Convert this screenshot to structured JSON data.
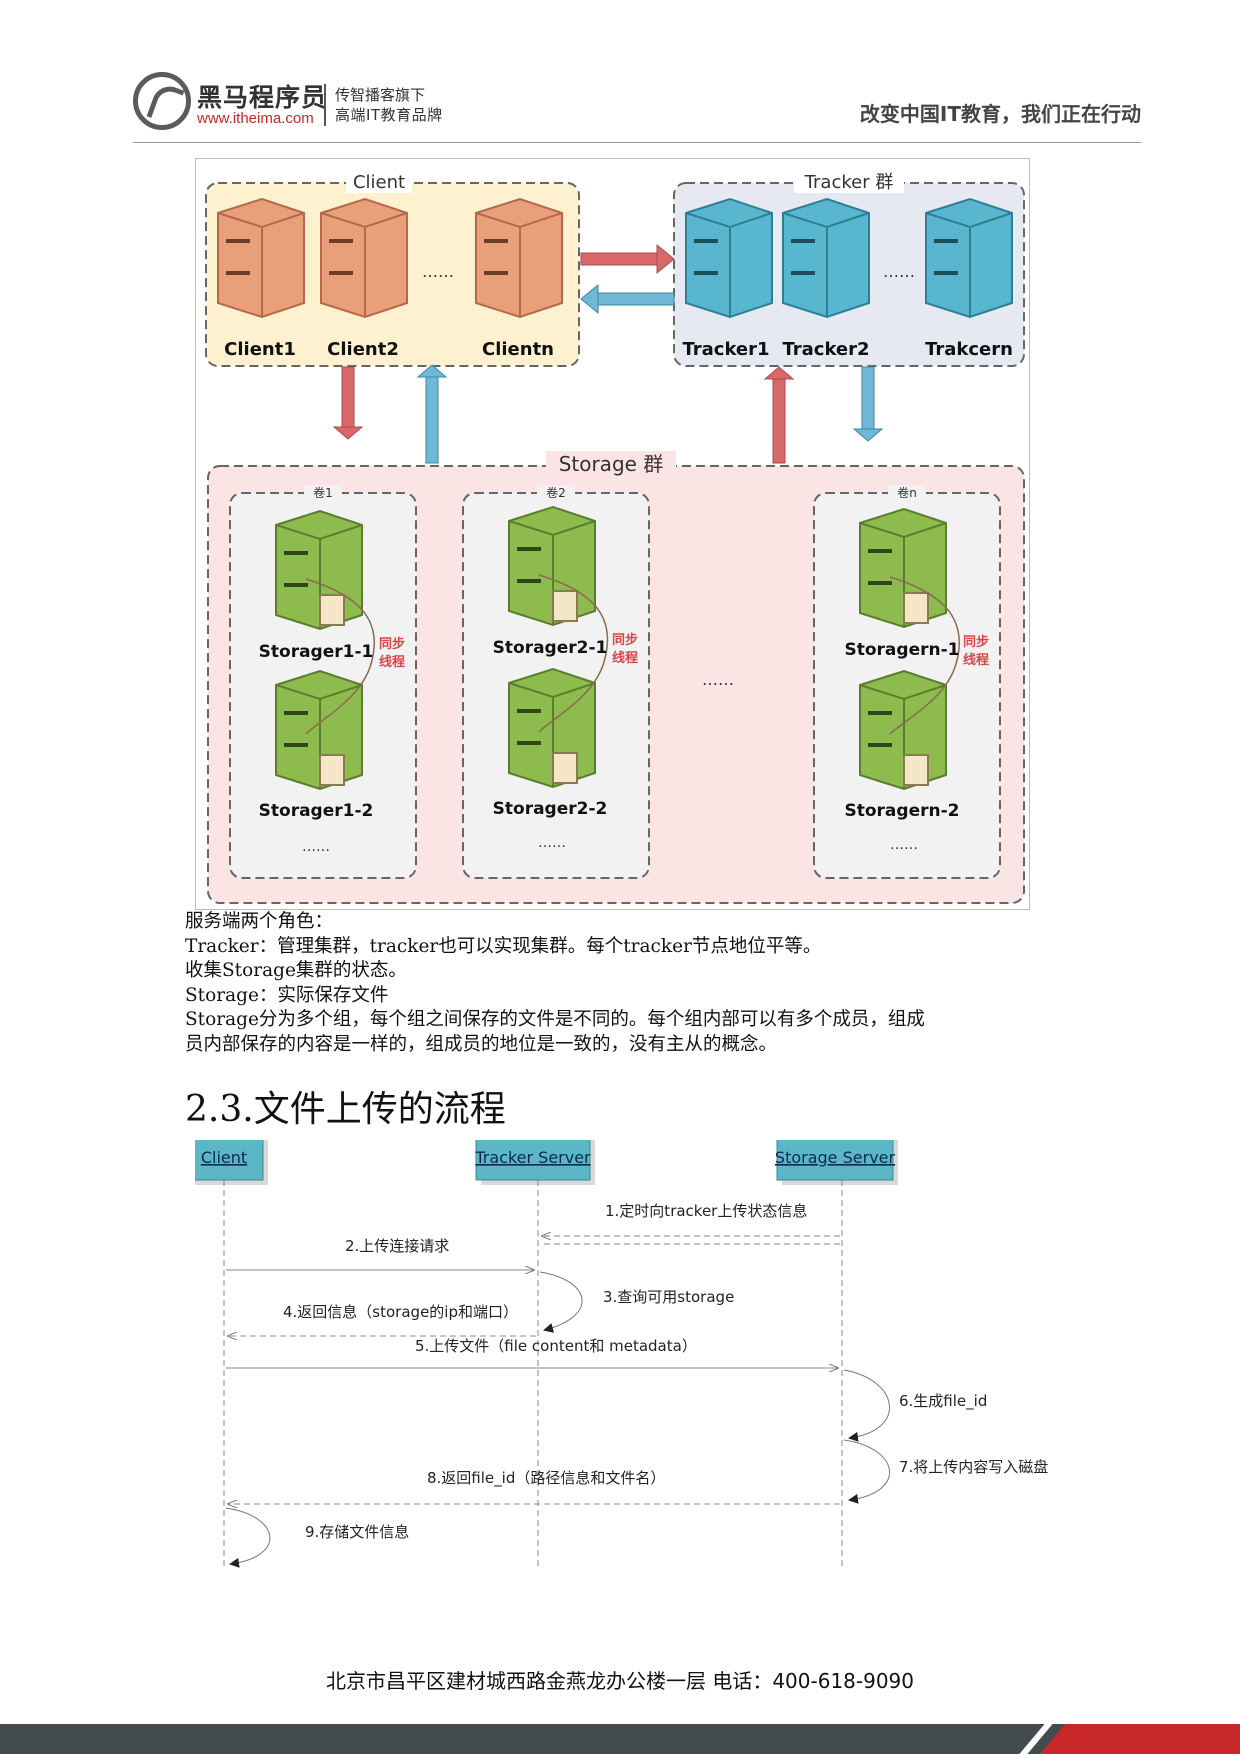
{
  "header": {
    "brand_name": "黑马程序员",
    "brand_url": "www.itheima.com",
    "tagline_1": "传智播客旗下",
    "tagline_2": "高端IT教育品牌",
    "slogan": "改变中国IT教育，我们正在行动"
  },
  "architecture": {
    "client_group": {
      "title": "Client",
      "nodes": [
        "Client1",
        "Client2",
        "Clientn"
      ],
      "ellipsis": "……"
    },
    "tracker_group": {
      "title": "Tracker 群",
      "nodes": [
        "Tracker1",
        "Tracker2",
        "Trakcern"
      ],
      "ellipsis": "……"
    },
    "storage_group": {
      "title": "Storage 群",
      "middle_ellipsis": "……",
      "sync_label_1": "同步",
      "sync_label_2": "线程",
      "volumes": [
        {
          "title": "卷1",
          "nodes": [
            "Storager1-1",
            "Storager1-2"
          ],
          "ellipsis": "……"
        },
        {
          "title": "卷2",
          "nodes": [
            "Storager2-1",
            "Storager2-2"
          ],
          "ellipsis": "……"
        },
        {
          "title": "卷n",
          "nodes": [
            "Storagern-1",
            "Storagern-2"
          ],
          "ellipsis": "……"
        }
      ]
    },
    "colors": {
      "client_fill": "#fdf1cf",
      "tracker_fill": "#e6e9f2",
      "storage_fill": "#fbe4e4",
      "client_server": "#e9a07a",
      "tracker_server": "#58b6cf",
      "storage_server": "#8dbb4e",
      "arrow_red": "#d9686a",
      "arrow_blue": "#6fb9d6"
    }
  },
  "body": {
    "lines": [
      "服务端两个角色：",
      "Tracker：管理集群，tracker也可以实现集群。每个tracker节点地位平等。",
      "收集Storage集群的状态。",
      "Storage：实际保存文件",
      "Storage分为多个组，每个组之间保存的文件是不同的。每个组内部可以有多个成员，组成",
      "员内部保存的内容是一样的，组成员的地位是一致的，没有主从的概念。"
    ]
  },
  "section": {
    "title": "2.3.文件上传的流程"
  },
  "sequence": {
    "participants": [
      "Client",
      "Tracker Server",
      "Storage Server"
    ],
    "messages": [
      "1.定时向tracker上传状态信息",
      "2.上传连接请求",
      "3.查询可用storage",
      "4.返回信息（storage的ip和端口）",
      "5.上传文件（file content和 metadata）",
      "6.生成file_id",
      "7.将上传内容写入磁盘",
      "8.返回file_id（路径信息和文件名）",
      "9.存储文件信息"
    ],
    "colors": {
      "participant_fill": "#5bb7c6",
      "line": "#888888"
    }
  },
  "footer": {
    "address": "北京市昌平区建材城西路金燕龙办公楼一层   电话：400-618-9090"
  }
}
